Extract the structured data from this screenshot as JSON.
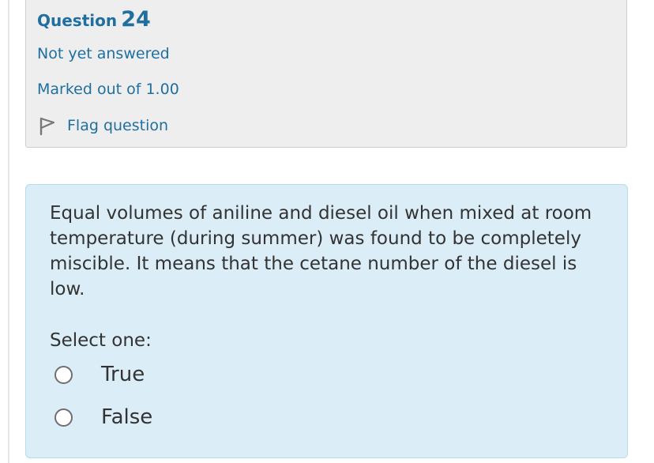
{
  "question": {
    "label": "Question",
    "number": "24",
    "state": "Not yet answered",
    "grade": "Marked out of 1.00",
    "flag_label": "Flag question",
    "flag_icon": "flag-outline-icon"
  },
  "content": {
    "text": "Equal volumes of aniline and diesel oil when mixed at room temperature (during summer) was found to be completely miscible. It means that the cetane number of the diesel is low.",
    "prompt": "Select one:",
    "options": [
      {
        "label": "True",
        "selected": false
      },
      {
        "label": "False",
        "selected": false
      }
    ]
  },
  "colors": {
    "link": "#1f6fa1",
    "info_bg": "#eeeeee",
    "content_bg": "#dbedf6",
    "content_border": "#b8dcec"
  }
}
